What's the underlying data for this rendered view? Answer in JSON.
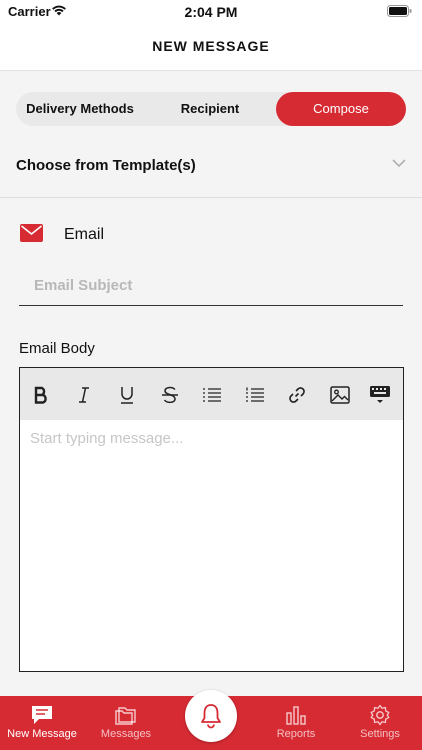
{
  "status_bar": {
    "carrier": "Carrier",
    "time": "2:04 PM"
  },
  "nav": {
    "title": "NEW MESSAGE"
  },
  "segments": [
    {
      "label": "Delivery Methods"
    },
    {
      "label": "Recipient"
    },
    {
      "label": "Compose",
      "selected": true
    }
  ],
  "template": {
    "label": "Choose from Template(s)"
  },
  "email": {
    "label": "Email",
    "subject_placeholder": "Email Subject",
    "subject_value": "",
    "body_label": "Email Body",
    "body_placeholder": "Start typing message...",
    "body_value": ""
  },
  "toolbar": {
    "icons": [
      "bold-icon",
      "italic-icon",
      "underline-icon",
      "strikethrough-icon",
      "unordered-list-icon",
      "ordered-list-icon",
      "link-icon",
      "image-icon",
      "keyboard-hide-icon"
    ]
  },
  "tabs": [
    {
      "label": "New Message",
      "icon": "compose-icon",
      "active": true
    },
    {
      "label": "Messages",
      "icon": "folder-icon",
      "active": false
    },
    {
      "label": "",
      "icon": "bell-icon",
      "active": false
    },
    {
      "label": "Reports",
      "icon": "bar-chart-icon",
      "active": false
    },
    {
      "label": "Settings",
      "icon": "gear-icon",
      "active": false
    }
  ],
  "colors": {
    "accent": "#d72b34",
    "background": "#f4f4f4",
    "toolbar": "#e8e8e8"
  }
}
